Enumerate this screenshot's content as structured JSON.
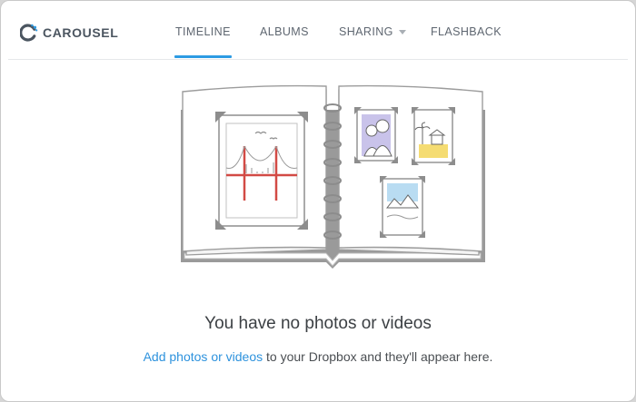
{
  "app": {
    "name": "CAROUSEL"
  },
  "nav": {
    "items": [
      {
        "label": "TIMELINE",
        "active": true
      },
      {
        "label": "ALBUMS",
        "active": false
      },
      {
        "label": "SHARING",
        "active": false,
        "dropdown": true
      },
      {
        "label": "FLASHBACK",
        "active": false
      }
    ]
  },
  "empty_state": {
    "title": "You have no photos or videos",
    "link_text": "Add photos or videos",
    "message_rest": " to your Dropbox and they'll appear here."
  },
  "colors": {
    "accent": "#2d9be3",
    "text_dark": "#3c4044",
    "nav_text": "#5e6670"
  },
  "icons": {
    "logo": "carousel-logo-icon",
    "dropdown": "chevron-down-icon"
  }
}
